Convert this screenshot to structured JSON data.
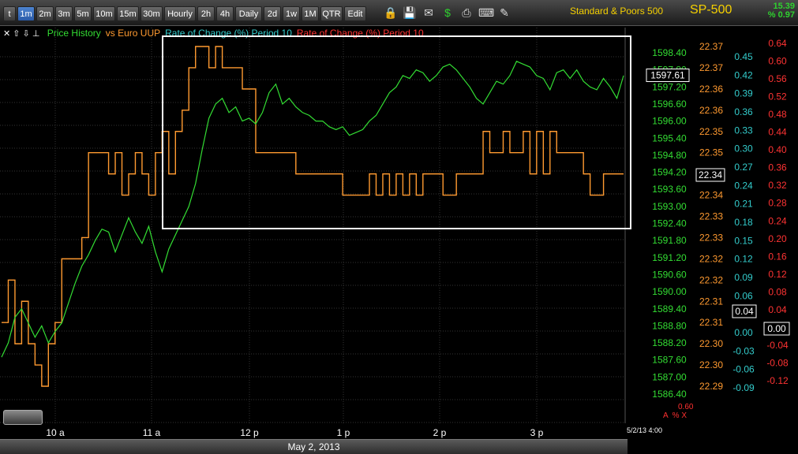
{
  "toolbar": {
    "buttons": [
      "t",
      "1m",
      "2m",
      "3m",
      "5m",
      "10m",
      "15m",
      "30m",
      "Hourly",
      "2h",
      "4h",
      "Daily",
      "2d",
      "1w",
      "1M",
      "QTR",
      "Edit"
    ],
    "active": "1m",
    "icons": [
      "lock-icon",
      "save-icon",
      "email-icon",
      "dollar-icon",
      "print-icon",
      "keyboard-icon",
      "pencil-icon"
    ]
  },
  "symbol": {
    "name": "Standard & Poors 500",
    "ticker": "SP-500",
    "change_points": "15.39",
    "change_percent": "% 0.97"
  },
  "legend": {
    "items": [
      {
        "label": "Price History",
        "color": "#33dd33"
      },
      {
        "label": "vs Euro UUP",
        "color": "#ff9a30"
      },
      {
        "label": "Rate of Change (%) Period 10",
        "color": "#33cccc"
      },
      {
        "label": "Rate of Change (%) Period 10",
        "color": "#ff3333"
      }
    ]
  },
  "chart_data": {
    "type": "line",
    "x": [
      "10 a",
      "11 a",
      "12 p",
      "1 p",
      "2 p",
      "3 p"
    ],
    "x_range_label": "May 2, 2013",
    "last_timestamp": "5/2/13 4:00",
    "axes": {
      "price": {
        "color": "#33dd33",
        "ticks": [
          "1598.40",
          "1597.80",
          "1597.20",
          "1596.60",
          "1596.00",
          "1595.40",
          "1594.80",
          "1594.20",
          "1593.60",
          "1593.00",
          "1592.40",
          "1591.80",
          "1591.20",
          "1590.60",
          "1590.00",
          "1589.40",
          "1588.80",
          "1588.20",
          "1587.60",
          "1587.00",
          "1586.40"
        ],
        "range": [
          1586.4,
          1598.4
        ],
        "current": "1597.61"
      },
      "uup": {
        "color": "#ff9a30",
        "ticks": [
          "22.37",
          "22.37",
          "22.36",
          "22.36",
          "22.35",
          "22.35",
          "22.34",
          "22.34",
          "22.33",
          "22.33",
          "22.32",
          "22.32",
          "22.31",
          "22.31",
          "22.30",
          "22.30",
          "22.29"
        ],
        "range": [
          22.29,
          22.37
        ],
        "current": "22.34"
      },
      "roc_cyan": {
        "color": "#33cccc",
        "ticks": [
          "0.45",
          "0.42",
          "0.39",
          "0.36",
          "0.33",
          "0.30",
          "0.27",
          "0.24",
          "0.21",
          "0.18",
          "0.15",
          "0.12",
          "0.09",
          "0.06",
          "0.03",
          "0.00",
          "-0.03",
          "-0.06",
          "-0.09"
        ],
        "range": [
          -0.09,
          0.45
        ],
        "current": "0.04"
      },
      "roc_red": {
        "color": "#ff3333",
        "ticks": [
          "0.64",
          "0.60",
          "0.56",
          "0.52",
          "0.48",
          "0.44",
          "0.40",
          "0.36",
          "0.32",
          "0.28",
          "0.24",
          "0.20",
          "0.16",
          "0.12",
          "0.08",
          "0.04",
          "0.00",
          "-0.04",
          "-0.08",
          "-0.12"
        ],
        "range": [
          -0.12,
          0.64
        ],
        "current": "0.00"
      }
    },
    "series": [
      {
        "name": "Price History",
        "color": "#33dd33",
        "values": [
          1587.7,
          1588.2,
          1589.1,
          1589.4,
          1588.9,
          1588.4,
          1588.8,
          1588.2,
          1588.6,
          1588.9,
          1589.6,
          1590.3,
          1590.9,
          1591.3,
          1591.8,
          1592.2,
          1592.1,
          1591.4,
          1592.0,
          1592.6,
          1592.1,
          1591.7,
          1592.3,
          1591.4,
          1590.7,
          1591.5,
          1592.0,
          1592.5,
          1593.0,
          1593.8,
          1595.0,
          1596.1,
          1596.6,
          1596.8,
          1596.3,
          1596.5,
          1596.0,
          1596.1,
          1595.9,
          1596.3,
          1597.0,
          1597.3,
          1596.6,
          1596.8,
          1596.5,
          1596.3,
          1596.2,
          1596.0,
          1596.0,
          1595.8,
          1595.7,
          1595.8,
          1595.5,
          1595.6,
          1595.7,
          1596.0,
          1596.2,
          1596.6,
          1597.0,
          1597.2,
          1597.6,
          1597.5,
          1597.8,
          1597.7,
          1597.4,
          1597.6,
          1597.9,
          1598.0,
          1597.8,
          1597.5,
          1597.2,
          1596.8,
          1596.6,
          1597.0,
          1597.4,
          1597.3,
          1597.6,
          1598.1,
          1598.0,
          1597.9,
          1597.6,
          1597.5,
          1597.1,
          1597.7,
          1597.8,
          1597.5,
          1597.8,
          1597.4,
          1597.2,
          1597.1,
          1597.5,
          1597.2,
          1596.8,
          1597.6
        ]
      },
      {
        "name": "vs Euro UUP",
        "color": "#ff9a30",
        "values": [
          22.305,
          22.315,
          22.3,
          22.31,
          22.3,
          22.295,
          22.29,
          22.3,
          22.305,
          22.32,
          22.32,
          22.32,
          22.325,
          22.345,
          22.345,
          22.345,
          22.34,
          22.345,
          22.335,
          22.34,
          22.345,
          22.34,
          22.335,
          22.345,
          22.35,
          22.34,
          22.35,
          22.355,
          22.365,
          22.37,
          22.37,
          22.365,
          22.37,
          22.365,
          22.365,
          22.365,
          22.36,
          22.36,
          22.345,
          22.345,
          22.345,
          22.345,
          22.345,
          22.345,
          22.34,
          22.34,
          22.34,
          22.34,
          22.34,
          22.34,
          22.34,
          22.335,
          22.335,
          22.335,
          22.335,
          22.34,
          22.335,
          22.34,
          22.335,
          22.34,
          22.335,
          22.34,
          22.335,
          22.34,
          22.34,
          22.34,
          22.335,
          22.335,
          22.34,
          22.34,
          22.34,
          22.34,
          22.35,
          22.345,
          22.345,
          22.35,
          22.345,
          22.345,
          22.35,
          22.34,
          22.35,
          22.34,
          22.35,
          22.345,
          22.345,
          22.345,
          22.345,
          22.34,
          22.335,
          22.335,
          22.34,
          22.34,
          22.34,
          22.34
        ]
      }
    ],
    "annotation": {
      "type": "rectangle",
      "color": "#ffffff",
      "x_from": "11 a",
      "x_to": "4 p"
    }
  },
  "corner": {
    "value": "0.60",
    "icons_text": "A  % X"
  }
}
